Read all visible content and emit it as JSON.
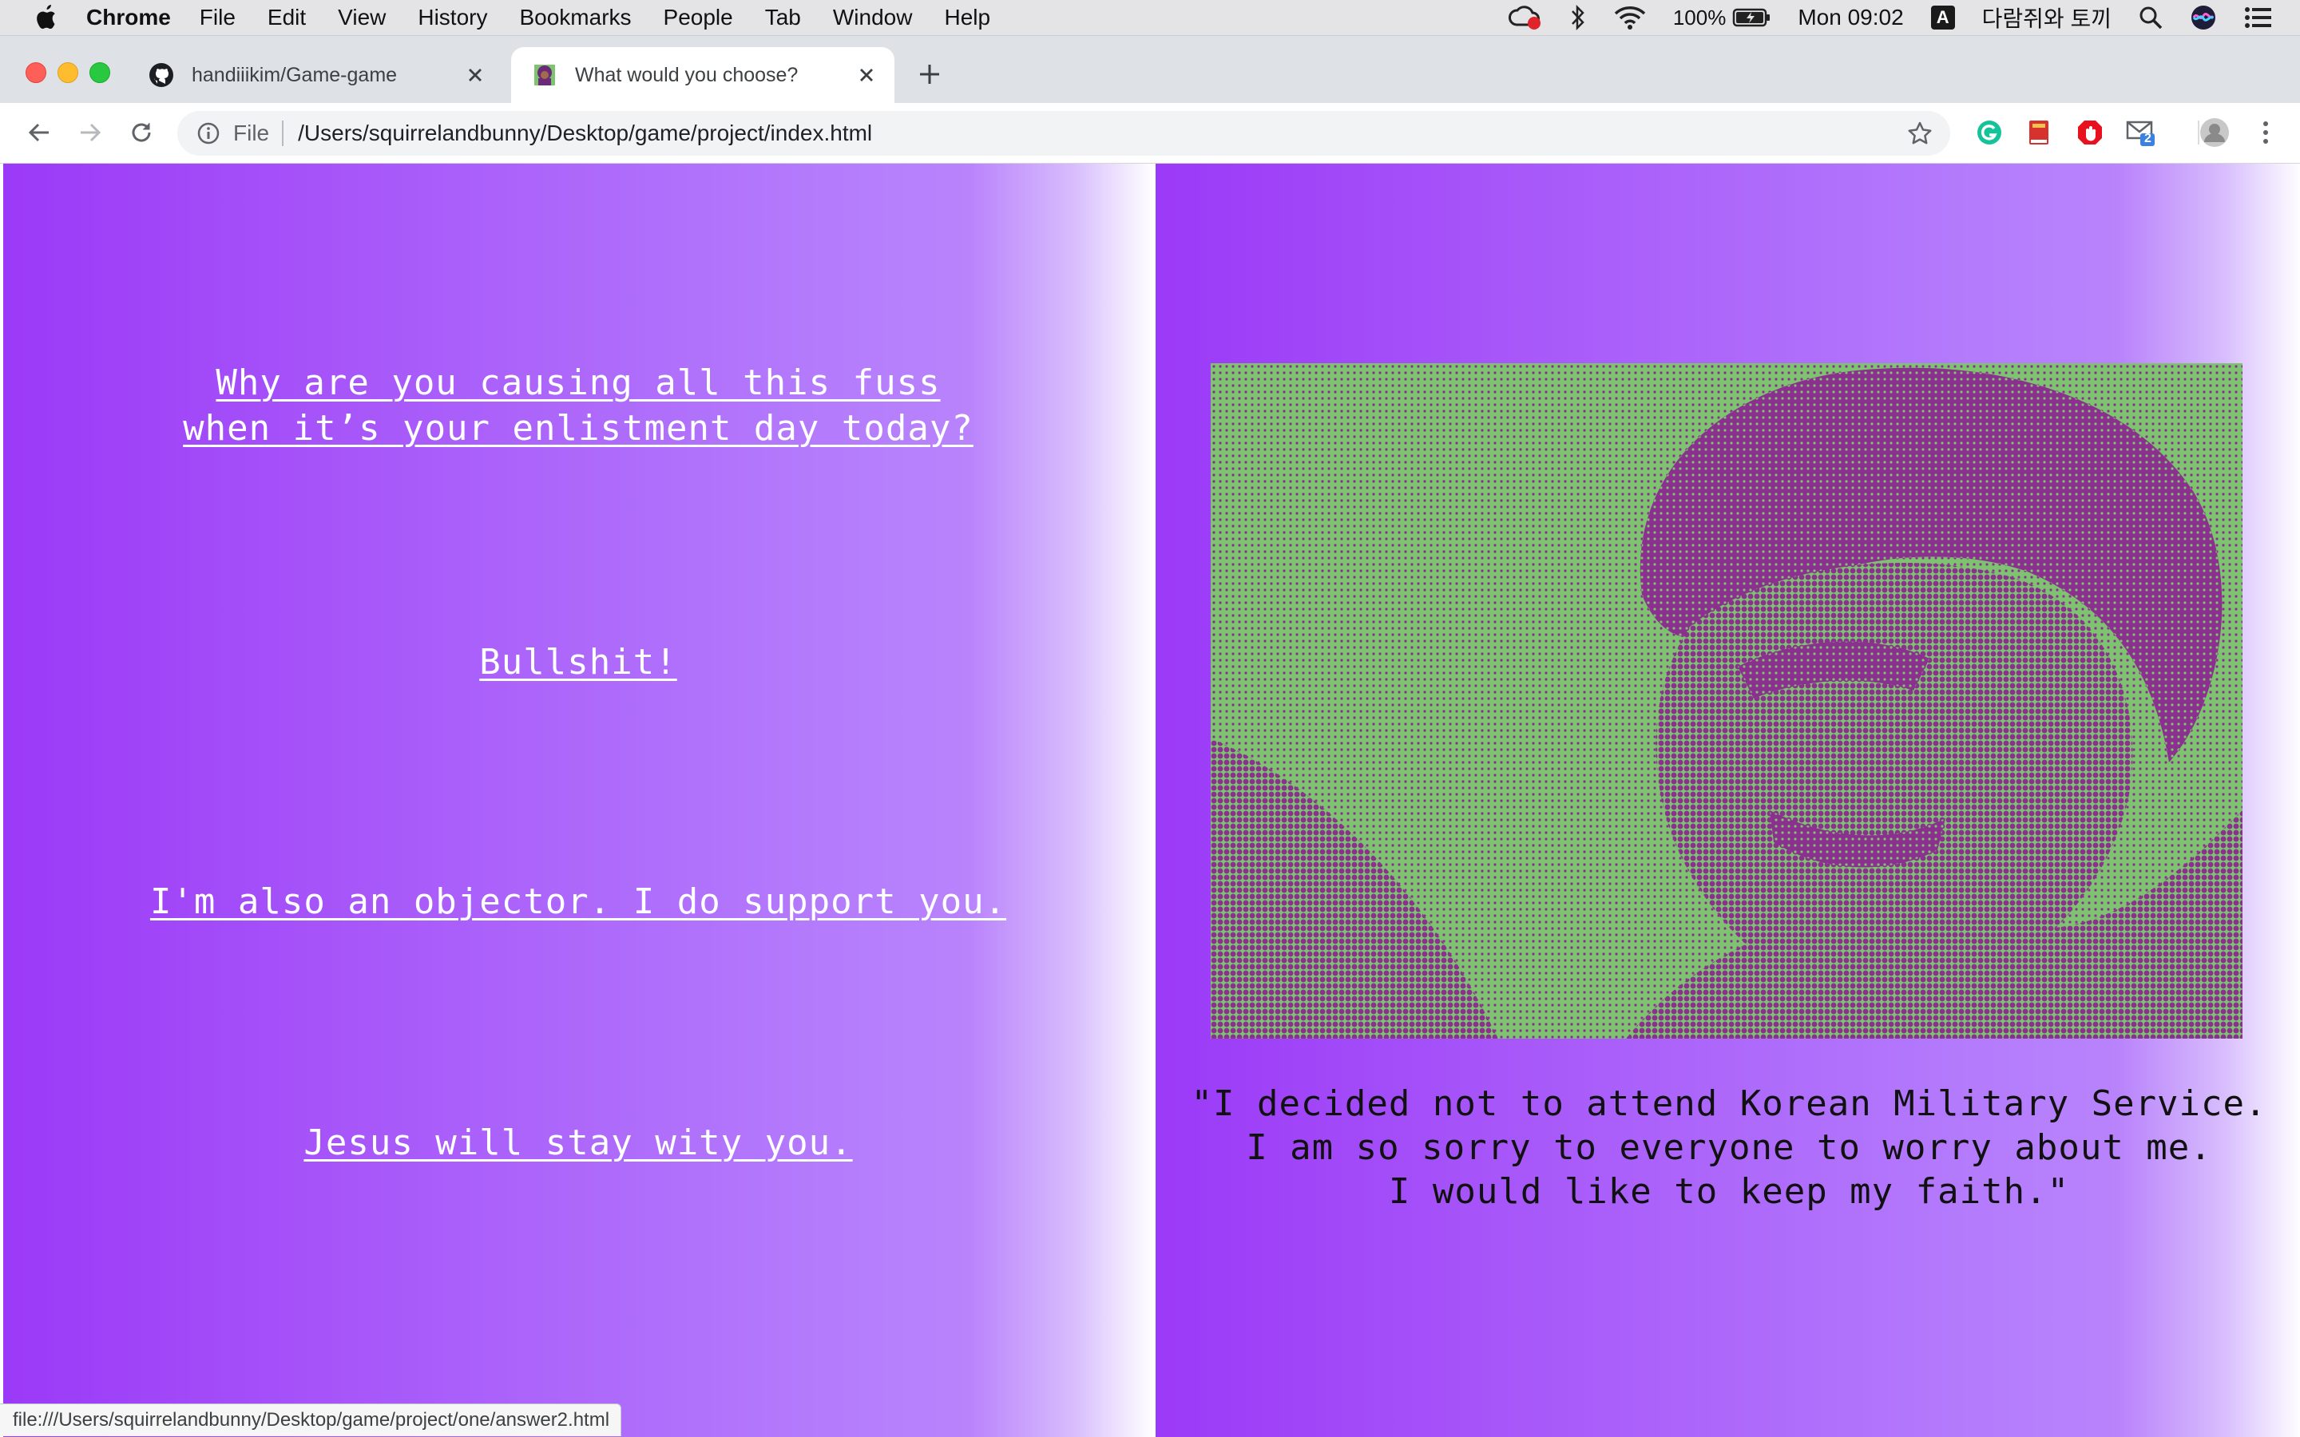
{
  "menubar": {
    "app_name": "Chrome",
    "menus": [
      "File",
      "Edit",
      "View",
      "History",
      "Bookmarks",
      "People",
      "Tab",
      "Window",
      "Help"
    ],
    "battery": "100%",
    "clock": "Mon 09:02",
    "input_source": "A",
    "user_name": "다람쥐와 토끼"
  },
  "tabs": [
    {
      "title": "handiiikim/Game-game",
      "favicon": "github-icon",
      "active": false
    },
    {
      "title": "What would you choose?",
      "favicon": "avatar-favicon",
      "active": true
    }
  ],
  "toolbar": {
    "scheme_chip": "File",
    "url": "/Users/squirrelandbunny/Desktop/game/project/index.html",
    "mail_badge": "2"
  },
  "page": {
    "options": [
      {
        "lines": [
          "Why are you causing all this fuss",
          "when it’s your enlistment day today?"
        ]
      },
      {
        "lines": [
          "Bullshit!"
        ]
      },
      {
        "lines": [
          "I'm also an objector. I do support you."
        ]
      },
      {
        "lines": [
          "Jesus will stay wity you."
        ]
      }
    ],
    "quote_lines": [
      "\"I decided not to attend Korean Military Service.",
      "I am so sorry to everyone to worry about me.",
      "I would like to keep my faith.\""
    ],
    "colors": {
      "gradient_start": "#9b39f8",
      "gradient_mid": "#b47cfc",
      "halftone_green": "#7dc370",
      "halftone_purple": "#8b308e"
    }
  },
  "status_bar": {
    "link_url": "file:///Users/squirrelandbunny/Desktop/game/project/one/answer2.html"
  }
}
